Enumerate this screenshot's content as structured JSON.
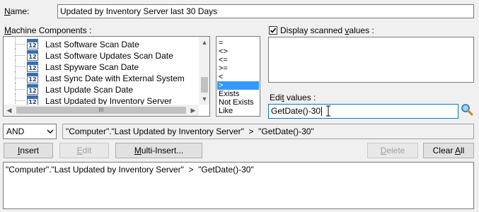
{
  "name": {
    "label": "Name:",
    "value": "Updated by Inventory Server last 30 Days"
  },
  "machine_components": {
    "label": "Machine Components :",
    "items": [
      {
        "label": "Last Software Scan Date",
        "icon": "calendar-icon",
        "icon_text": "12"
      },
      {
        "label": "Last Software Updates Scan Date",
        "icon": "calendar-icon",
        "icon_text": "12"
      },
      {
        "label": "Last Spyware Scan Date",
        "icon": "calendar-icon",
        "icon_text": "12"
      },
      {
        "label": "Last Sync Date with External System",
        "icon": "calendar-icon",
        "icon_text": "12"
      },
      {
        "label": "Last Update Scan Date",
        "icon": "calendar-icon",
        "icon_text": "12"
      },
      {
        "label": "Last Updated by Inventory Server",
        "icon": "calendar-icon",
        "icon_text": "12"
      }
    ],
    "hscroll_grip": "III"
  },
  "operators": {
    "items": [
      "=",
      "<>",
      "<=",
      ">=",
      "<",
      ">",
      "Exists",
      "Not Exists",
      "Like"
    ],
    "selected": ">"
  },
  "display_scanned": {
    "label": "Display scanned values :",
    "checked": true
  },
  "edit_values": {
    "label": "Edit values :",
    "value": "GetDate()-30"
  },
  "logic": {
    "selected": "AND"
  },
  "expression_preview": "\"Computer\".\"Last Updated by Inventory Server\"  >  \"GetDate()-30\"",
  "buttons": {
    "insert": "Insert",
    "edit": "Edit",
    "multi_insert": "Multi-Insert...",
    "delete": "Delete",
    "clear_all": "Clear All"
  },
  "query_text": "\"Computer\".\"Last Updated by Inventory Server\"  >  \"GetDate()-30\"",
  "colors": {
    "selection": "#3399ff",
    "focus_border": "#0078d7"
  }
}
